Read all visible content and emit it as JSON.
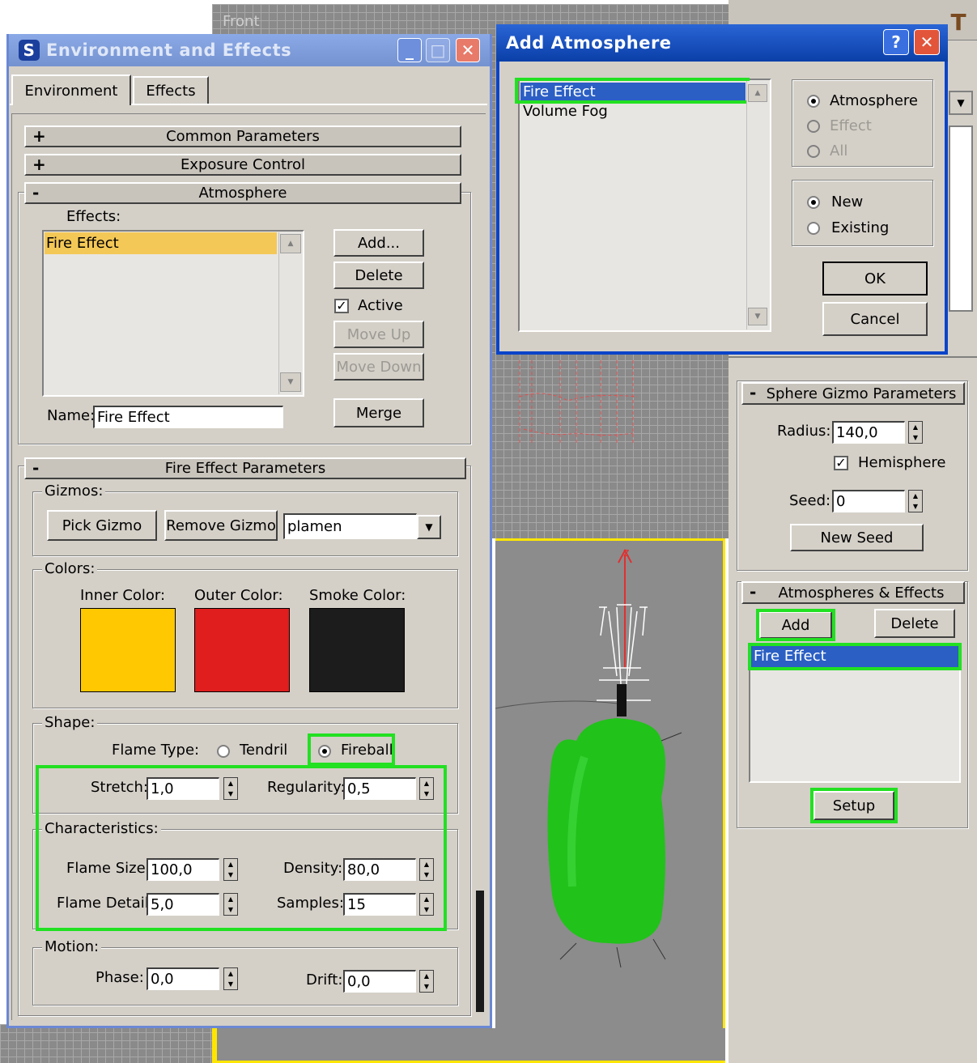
{
  "viewports": {
    "top_label": "Front"
  },
  "env_window": {
    "title": "Environment and Effects",
    "tabs": [
      "Environment",
      "Effects"
    ],
    "rollouts": {
      "common": "Common Parameters",
      "exposure": "Exposure Control",
      "atmosphere": "Atmosphere",
      "fire_params": "Fire Effect Parameters"
    },
    "effects_label": "Effects:",
    "effects_list": [
      "Fire Effect"
    ],
    "buttons": {
      "add": "Add...",
      "delete": "Delete",
      "active": "Active",
      "move_up": "Move Up",
      "move_down": "Move Down",
      "merge": "Merge"
    },
    "name_label": "Name:",
    "name_value": "Fire Effect",
    "gizmos": {
      "label": "Gizmos:",
      "pick": "Pick Gizmo",
      "remove": "Remove Gizmo",
      "selected": "plamen"
    },
    "colors": {
      "label": "Colors:",
      "inner_label": "Inner Color:",
      "outer_label": "Outer Color:",
      "smoke_label": "Smoke Color:",
      "inner": "#ffc800",
      "outer": "#e01e1e",
      "smoke": "#1c1c1c"
    },
    "shape": {
      "label": "Shape:",
      "flame_type_label": "Flame Type:",
      "tendril": "Tendril",
      "fireball": "Fireball",
      "stretch_label": "Stretch:",
      "stretch": "1,0",
      "regularity_label": "Regularity:",
      "regularity": "0,5"
    },
    "characteristics": {
      "label": "Characteristics:",
      "flame_size_label": "Flame Size:",
      "flame_size": "100,0",
      "density_label": "Density:",
      "density": "80,0",
      "flame_detail_label": "Flame Detail:",
      "flame_detail": "5,0",
      "samples_label": "Samples:",
      "samples": "15"
    },
    "motion": {
      "label": "Motion:",
      "phase_label": "Phase:",
      "phase": "0,0",
      "drift_label": "Drift:",
      "drift": "0,0"
    }
  },
  "add_dialog": {
    "title": "Add Atmosphere",
    "list": [
      "Fire Effect",
      "Volume Fog"
    ],
    "type_options": [
      "Atmosphere",
      "Effect",
      "All"
    ],
    "source_options": [
      "New",
      "Existing"
    ],
    "ok": "OK",
    "cancel": "Cancel"
  },
  "side_panel": {
    "sphere_rollout": "Sphere Gizmo Parameters",
    "radius_label": "Radius:",
    "radius": "140,0",
    "hemisphere": "Hemisphere",
    "seed_label": "Seed:",
    "seed": "0",
    "new_seed": "New Seed",
    "atm_rollout": "Atmospheres & Effects",
    "add": "Add",
    "delete": "Delete",
    "list": [
      "Fire Effect"
    ],
    "setup": "Setup"
  },
  "accent_color": "#22e022"
}
